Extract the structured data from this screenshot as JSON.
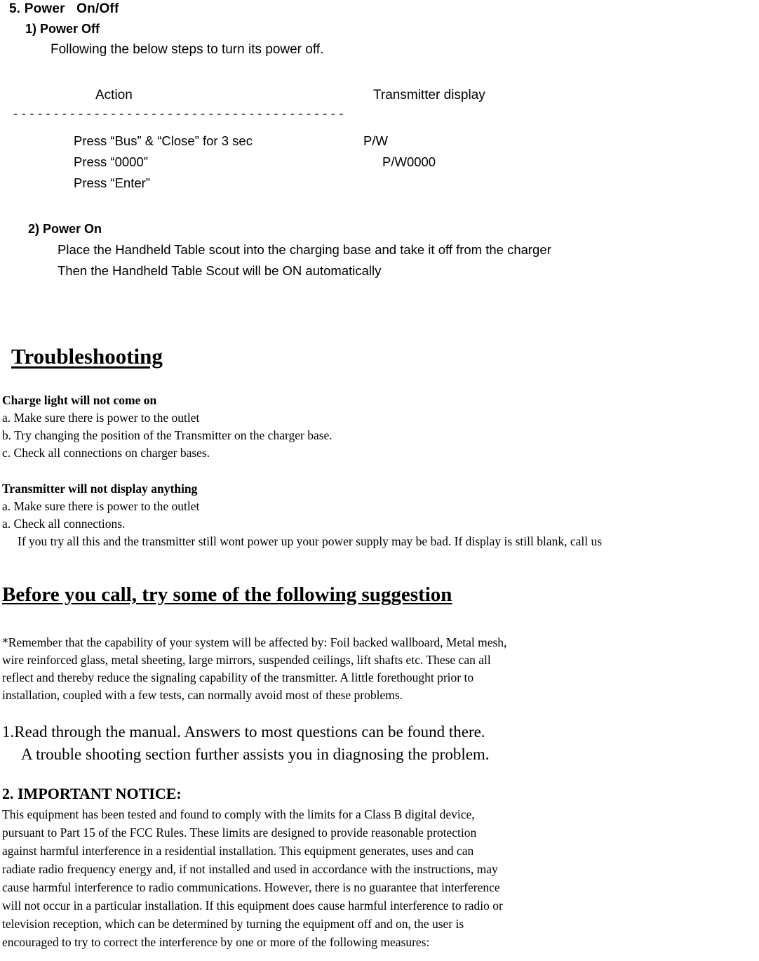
{
  "document": {
    "section5": {
      "heading": "5. Power   On/Off",
      "sub1": {
        "heading": "1) Power Off",
        "intro": "Following the below steps to turn its power off.",
        "table": {
          "col_action": "Action",
          "col_display": "Transmitter display",
          "divider": "- - - - - - - - - - - - - - - - - - - - - - - - - - - - - - - - - - - - - - - - -",
          "rows": [
            {
              "action": "Press “Bus” & “Close” for 3 sec",
              "display": "P/W"
            },
            {
              "action": "Press “0000”",
              "display": "P/W0000"
            },
            {
              "action": "Press “Enter”",
              "display": ""
            }
          ]
        }
      },
      "sub2": {
        "heading": "2) Power On",
        "line1": "Place the Handheld Table scout into the charging base and take it off from the charger",
        "line2": "Then the Handheld Table Scout will be ON automatically"
      }
    },
    "troubleshooting": {
      "heading": "Troubleshooting",
      "group1": {
        "title": "Charge light will not come on",
        "items": [
          "a. Make sure there is power to the outlet",
          "b. Try changing the position of the Transmitter on the charger base.",
          "c. Check all connections on charger bases."
        ]
      },
      "group2": {
        "title": "Transmitter will not display anything",
        "items": [
          "a. Make sure there is power to the outlet",
          "a. Check all connections."
        ],
        "note": "If you try all this and the transmitter still wont power up your power supply may be bad. If display is still blank, call us"
      }
    },
    "before_call": {
      "heading": "Before you call, try some of the following suggestion",
      "remember_paragraph": [
        "*Remember that the capability of your system will be affected by: Foil backed wallboard, Metal mesh,",
        "wire reinforced glass, metal sheeting, large mirrors, suspended ceilings, lift shafts etc. These can all",
        "reflect and thereby reduce the signaling capability of the transmitter. A little forethought prior to",
        "installation, coupled with a few tests, can normally avoid most of these problems."
      ],
      "item1_line1": "1.Read through the manual. Answers to most questions can be found there.",
      "item1_line2": "A trouble shooting section further assists you in diagnosing the problem."
    },
    "important_notice": {
      "heading": "2. IMPORTANT NOTICE:",
      "paragraph": [
        "This equipment has been tested and found to comply with the limits for a Class B digital device,",
        "pursuant to Part 15 of the FCC Rules. These limits are designed to provide reasonable protection",
        "against harmful interference in a residential installation. This equipment generates, uses and can",
        "radiate radio frequency energy and, if not installed and used in accordance with the instructions, may",
        "cause harmful interference to radio communications. However, there is no guarantee that interference",
        "will not occur in a particular installation. If this equipment does cause harmful interference to radio or",
        "television reception, which can be determined by turning the equipment off and on, the user is",
        "encouraged to try to correct the interference by one or more of the following measures:"
      ]
    }
  }
}
